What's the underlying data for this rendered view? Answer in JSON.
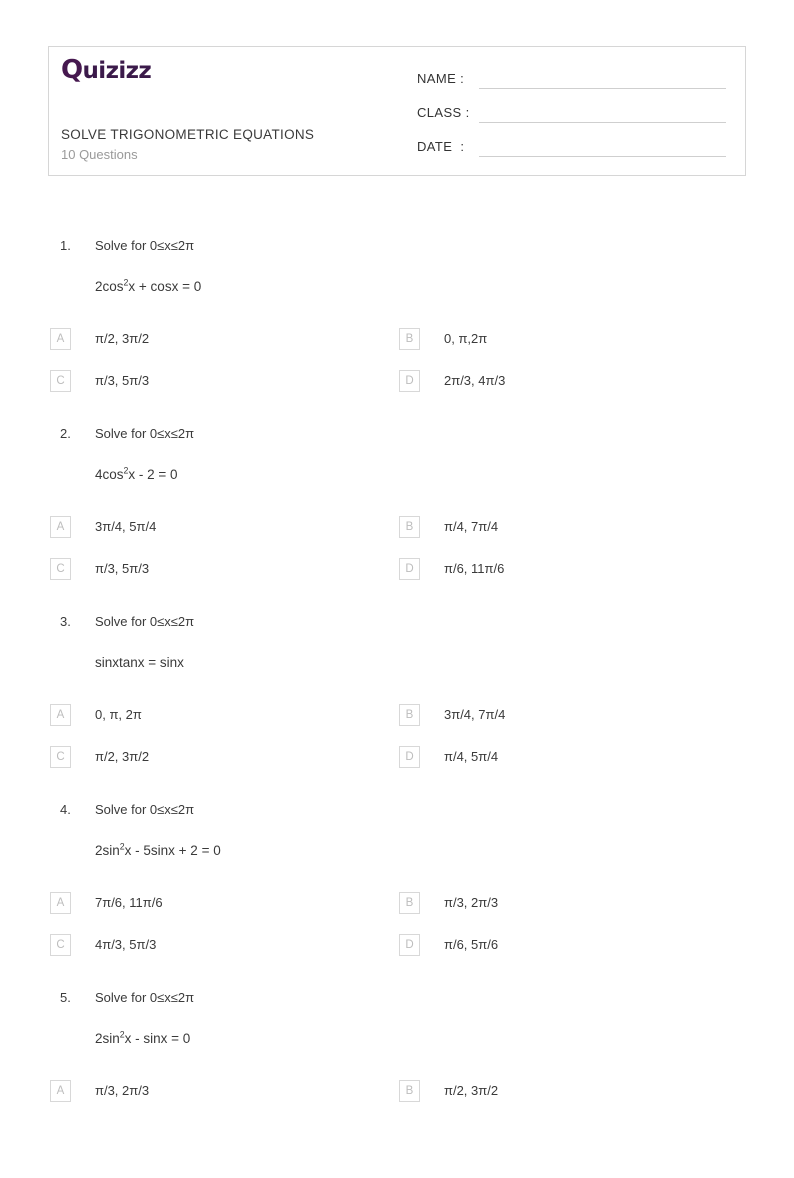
{
  "brand": {
    "logo_q": "Q",
    "logo_rest": "uizizz",
    "logo_full": "Quizizz",
    "logo_color": "#3b1a4a"
  },
  "header": {
    "title": "SOLVE TRIGONOMETRIC EQUATIONS",
    "subtitle": "10 Questions",
    "fields": [
      {
        "label": "NAME :",
        "value": ""
      },
      {
        "label": "CLASS :",
        "value": ""
      },
      {
        "label": "DATE  :",
        "value": ""
      }
    ]
  },
  "questions": [
    {
      "number": "1.",
      "prompt": "Solve for 0≤x≤2π",
      "equation_pre": "2cos",
      "equation_sup": "2",
      "equation_post": "x + cosx = 0",
      "options": [
        {
          "letter": "A",
          "text": "π/2, 3π/2"
        },
        {
          "letter": "B",
          "text": "0, π,2π"
        },
        {
          "letter": "C",
          "text": "π/3, 5π/3"
        },
        {
          "letter": "D",
          "text": "2π/3, 4π/3"
        }
      ]
    },
    {
      "number": "2.",
      "prompt": "Solve for 0≤x≤2π",
      "equation_pre": "4cos",
      "equation_sup": "2",
      "equation_post": "x - 2 = 0",
      "options": [
        {
          "letter": "A",
          "text": "3π/4, 5π/4"
        },
        {
          "letter": "B",
          "text": "π/4, 7π/4"
        },
        {
          "letter": "C",
          "text": "π/3, 5π/3"
        },
        {
          "letter": "D",
          "text": "π/6, 11π/6"
        }
      ]
    },
    {
      "number": "3.",
      "prompt": "Solve for 0≤x≤2π",
      "equation_pre": "sinxtanx = sinx",
      "equation_sup": "",
      "equation_post": "",
      "options": [
        {
          "letter": "A",
          "text": "0, π, 2π"
        },
        {
          "letter": "B",
          "text": "3π/4, 7π/4"
        },
        {
          "letter": "C",
          "text": "π/2, 3π/2"
        },
        {
          "letter": "D",
          "text": "π/4, 5π/4"
        }
      ]
    },
    {
      "number": "4.",
      "prompt": "Solve for 0≤x≤2π",
      "equation_pre": "2sin",
      "equation_sup": "2",
      "equation_post": "x - 5sinx + 2 = 0",
      "options": [
        {
          "letter": "A",
          "text": "7π/6, 11π/6"
        },
        {
          "letter": "B",
          "text": "π/3, 2π/3"
        },
        {
          "letter": "C",
          "text": "4π/3, 5π/3"
        },
        {
          "letter": "D",
          "text": "π/6, 5π/6"
        }
      ]
    },
    {
      "number": "5.",
      "prompt": "Solve for 0≤x≤2π",
      "equation_pre": "2sin",
      "equation_sup": "2",
      "equation_post": "x - sinx = 0",
      "options": [
        {
          "letter": "A",
          "text": "π/3, 2π/3"
        },
        {
          "letter": "B",
          "text": "π/2, 3π/2"
        }
      ]
    }
  ]
}
